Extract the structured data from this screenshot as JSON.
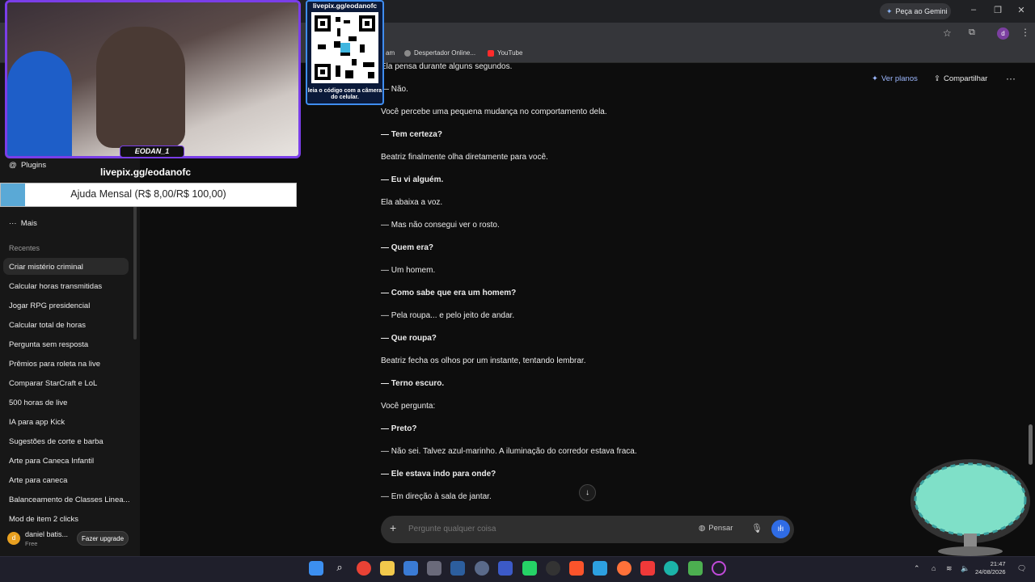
{
  "browser": {
    "gemini_btn": "Peça ao Gemini",
    "bookmarks": [
      {
        "label": "am"
      },
      {
        "label": "Despertador Online..."
      },
      {
        "label": "YouTube"
      }
    ]
  },
  "stream": {
    "qr_title": "livepix.gg/eodanofc",
    "qr_subtitle": "leia o código com a câmera do celular.",
    "cam_name": "EODAN_1",
    "livepix_url": "livepix.gg/eodanofc",
    "ajuda_text": "Ajuda Mensal (R$ 8,00/R$ 100,00)"
  },
  "sidebar": {
    "plugins": "Plugins",
    "mais": "Mais",
    "recentes_heading": "Recentes",
    "recentes": [
      "Criar mistério criminal",
      "Calcular horas transmitidas",
      "Jogar RPG presidencial",
      "Calcular total de horas",
      "Pergunta sem resposta",
      "Prêmios para roleta na live",
      "Comparar StarCraft e LoL",
      "500 horas de live",
      "IA para app Kick",
      "Sugestões de corte e barba",
      "Arte para Caneca Infantil",
      "Arte para caneca",
      "Balanceamento de Classes Linea...",
      "Mod de item 2 clicks"
    ],
    "user_name": "daniel batis...",
    "user_plan": "Free",
    "upgrade": "Fazer upgrade"
  },
  "header": {
    "ver_planos": "Ver planos",
    "compartilhar": "Compartilhar"
  },
  "chat": {
    "lines": [
      {
        "text": "Ela pensa durante alguns segundos.",
        "bold": false
      },
      {
        "text": "— Não.",
        "bold": false
      },
      {
        "text": "Você percebe uma pequena mudança no comportamento dela.",
        "bold": false
      },
      {
        "text": "— Tem certeza?",
        "bold": true
      },
      {
        "text": "Beatriz finalmente olha diretamente para você.",
        "bold": false
      },
      {
        "text": "— Eu vi alguém.",
        "bold": true
      },
      {
        "text": "Ela abaixa a voz.",
        "bold": false
      },
      {
        "text": "— Mas não consegui ver o rosto.",
        "bold": false
      },
      {
        "text": "— Quem era?",
        "bold": true
      },
      {
        "text": "— Um homem.",
        "bold": false
      },
      {
        "text": "— Como sabe que era um homem?",
        "bold": true
      },
      {
        "text": "— Pela roupa... e pelo jeito de andar.",
        "bold": false
      },
      {
        "text": "— Que roupa?",
        "bold": true
      },
      {
        "text": "Beatriz fecha os olhos por um instante, tentando lembrar.",
        "bold": false
      },
      {
        "text": "— Terno escuro.",
        "bold": true
      },
      {
        "text": "Você pergunta:",
        "bold": false
      },
      {
        "text": "— Preto?",
        "bold": true
      },
      {
        "text": "— Não sei. Talvez azul-marinho. A iluminação do corredor estava fraca.",
        "bold": false
      },
      {
        "text": "— Ele estava indo para onde?",
        "bold": true
      },
      {
        "text": "— Em direção à sala de jantar.",
        "bold": false
      }
    ]
  },
  "composer": {
    "placeholder": "Pergunte qualquer coisa",
    "pensar": "Pensar"
  },
  "taskbar": {
    "time": "21:47",
    "date": "24/08/2026"
  }
}
